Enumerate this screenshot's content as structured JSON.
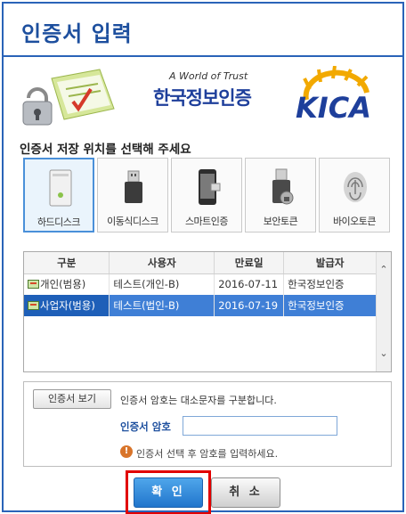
{
  "window": {
    "title": "인증서 입력"
  },
  "banner": {
    "tagline": "A World of Trust",
    "brand": "한국정보인증",
    "logo_text": "KICA"
  },
  "storage": {
    "prompt": "인증서 저장 위치를 선택해 주세요",
    "selected_index": 0,
    "items": [
      {
        "label": "하드디스크",
        "icon": "hard-disk-icon"
      },
      {
        "label": "이동식디스크",
        "icon": "usb-drive-icon"
      },
      {
        "label": "스마트인증",
        "icon": "smartphone-icon"
      },
      {
        "label": "보안토큰",
        "icon": "security-token-icon"
      },
      {
        "label": "바이오토큰",
        "icon": "fingerprint-icon"
      }
    ]
  },
  "cert_table": {
    "columns": [
      "구분",
      "사용자",
      "만료일",
      "발급자"
    ],
    "rows": [
      {
        "type": "개인(범용)",
        "user": "테스트(개인-B)",
        "expiry": "2016-07-11",
        "issuer": "한국정보인증",
        "selected": false
      },
      {
        "type": "사업자(범용)",
        "user": "테스트(법인-B)",
        "expiry": "2016-07-19",
        "issuer": "한국정보인증",
        "selected": true
      }
    ]
  },
  "password": {
    "view_cert_button": "인증서 보기",
    "case_note": "인증서 암호는 대소문자를 구분합니다.",
    "label": "인증서 암호",
    "value": "",
    "hint": "인증서 선택 후 암호를 입력하세요."
  },
  "buttons": {
    "confirm": "확 인",
    "cancel": "취 소"
  },
  "colors": {
    "accent": "#2a63b8",
    "selected_row": "#3f7fd6",
    "highlight": "#e10000"
  }
}
